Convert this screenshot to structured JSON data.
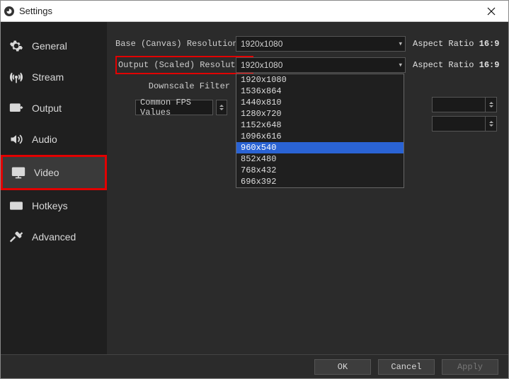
{
  "window": {
    "title": "Settings"
  },
  "sidebar": {
    "items": [
      {
        "label": "General"
      },
      {
        "label": "Stream"
      },
      {
        "label": "Output"
      },
      {
        "label": "Audio"
      },
      {
        "label": "Video"
      },
      {
        "label": "Hotkeys"
      },
      {
        "label": "Advanced"
      }
    ]
  },
  "labels": {
    "base_res": "Base (Canvas) Resolution",
    "output_res": "Output (Scaled) Resolution",
    "downscale": "Downscale Filter",
    "fps": "Common FPS Values",
    "aspect_prefix": "Aspect Ratio",
    "aspect_value": "16:9"
  },
  "values": {
    "base_res": "1920x1080",
    "output_res": "1920x1080"
  },
  "dropdown": {
    "options": [
      "1920x1080",
      "1536x864",
      "1440x810",
      "1280x720",
      "1152x648",
      "1096x616",
      "960x540",
      "852x480",
      "768x432",
      "696x392"
    ],
    "selected": "960x540"
  },
  "footer": {
    "ok": "OK",
    "cancel": "Cancel",
    "apply": "Apply"
  }
}
